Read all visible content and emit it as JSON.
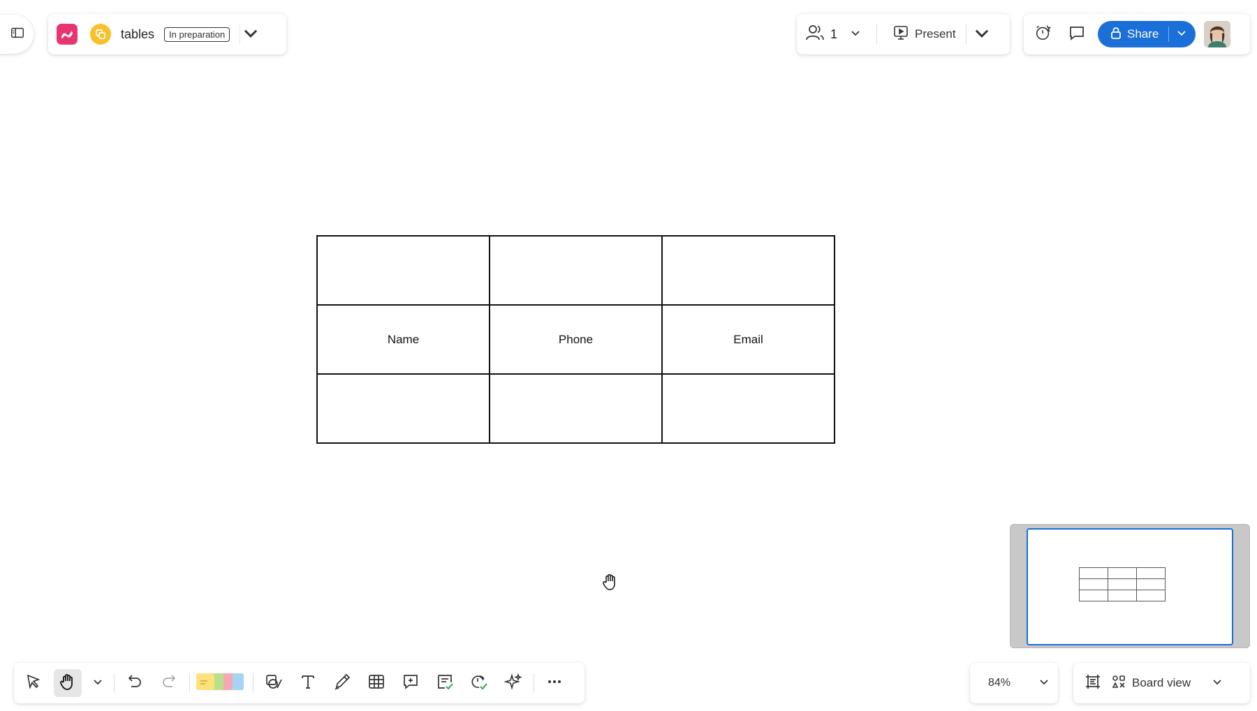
{
  "header": {
    "board_title": "tables",
    "status_badge": "In preparation"
  },
  "collaboration": {
    "collaborator_count": "1",
    "present_label": "Present"
  },
  "actions": {
    "share_label": "Share"
  },
  "canvas": {
    "table_rows": [
      [
        "",
        "",
        ""
      ],
      [
        "Name",
        "Phone",
        "Email"
      ],
      [
        "",
        "",
        ""
      ]
    ]
  },
  "minimap": {
    "rows": 3,
    "columns": 3
  },
  "zoom": {
    "level": "84%"
  },
  "view": {
    "label": "Board view"
  },
  "toolbar": {
    "tools": [
      "select-icon",
      "hand-icon",
      "undo-icon",
      "redo-icon",
      "sticky-notes-icon",
      "shapes-icon",
      "text-icon",
      "pen-icon",
      "table-icon",
      "comment-icon",
      "checklist-icon",
      "timer-check-icon",
      "ai-sparkle-icon",
      "more-icon"
    ],
    "active_tool": "hand-icon"
  },
  "colors": {
    "accent": "#1a6fd8",
    "app_logo": "#e8356f",
    "team_icon": "#fbbf2c"
  }
}
